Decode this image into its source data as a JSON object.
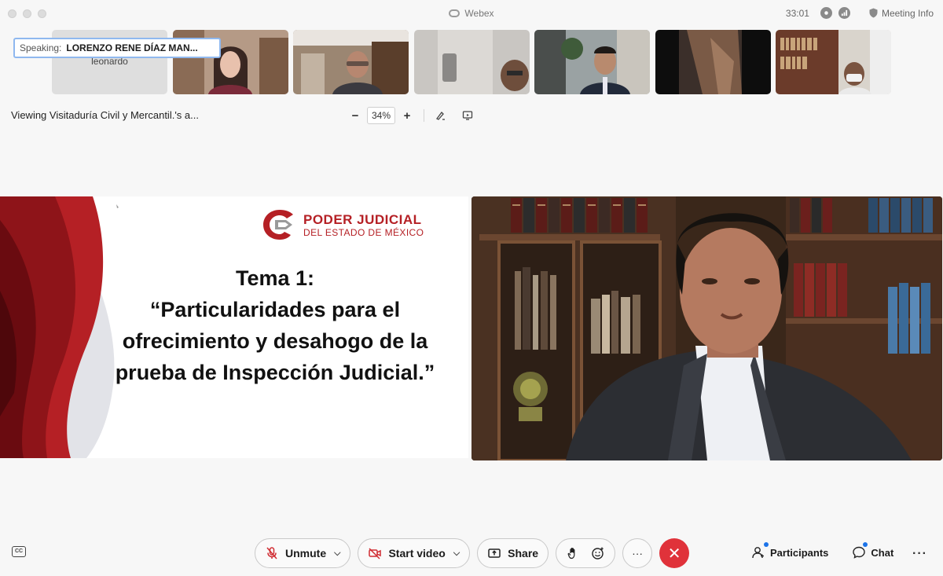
{
  "window": {
    "app_title": "Webex",
    "timer": "33:01",
    "meeting_info_label": "Meeting Info"
  },
  "speaking": {
    "prefix": "Speaking:",
    "name": "LORENZO RENE DÍAZ MAN..."
  },
  "thumbnails": [
    {
      "label": "leonardo",
      "type": "name-only"
    },
    {
      "label": "",
      "type": "video"
    },
    {
      "label": "",
      "type": "video"
    },
    {
      "label": "",
      "type": "video"
    },
    {
      "label": "",
      "type": "video"
    },
    {
      "label": "",
      "type": "video"
    },
    {
      "label": "",
      "type": "video"
    }
  ],
  "share": {
    "viewing_text": "Viewing Visitaduría Civil y Mercantil.'s a...",
    "zoom_minus": "−",
    "zoom_value": "34%",
    "zoom_plus": "+"
  },
  "slide": {
    "logo_line1": "PODER JUDICIAL",
    "logo_line2": "DEL ESTADO DE MÉXICO",
    "title_line1": "Tema 1:",
    "title_line2": "“Particularidades para el",
    "title_line3": "ofrecimiento y desahogo de la",
    "title_line4": "prueba de Inspección Judicial.”",
    "colors": {
      "dark_red": "#7d0f14",
      "red": "#b52025",
      "grey": "#e2e3e8"
    }
  },
  "controls": {
    "unmute_label": "Unmute",
    "start_video_label": "Start video",
    "share_label": "Share",
    "more_label": "···",
    "end_label": "✕",
    "participants_label": "Participants",
    "chat_label": "Chat",
    "overflow_label": "···",
    "cc_label": "CC",
    "end_color": "#e0323a",
    "notification_color": "#1c73e8"
  }
}
